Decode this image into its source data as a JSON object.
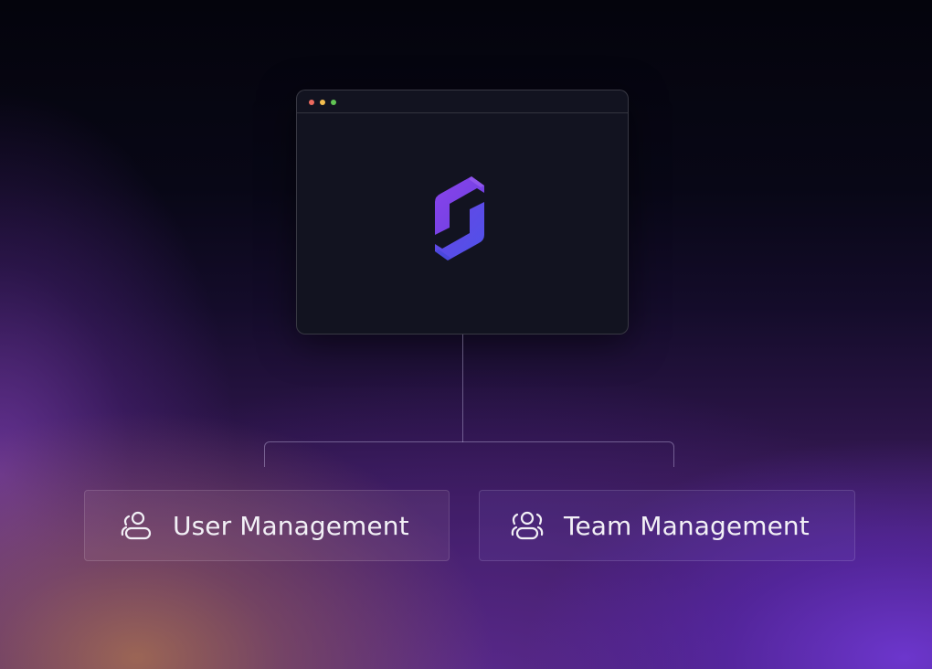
{
  "window": {
    "controls": [
      "red",
      "yellow",
      "green"
    ],
    "control_colors": {
      "red": "#ec6a5e",
      "yellow": "#f4be4f",
      "green": "#61c554"
    },
    "logo": {
      "icon": "s-logo-icon",
      "colors": [
        "#7b3fe4",
        "#5a4be8"
      ]
    }
  },
  "cards": [
    {
      "label": "User Management",
      "icon": "user-icon"
    },
    {
      "label": "Team Management",
      "icon": "team-icon"
    }
  ],
  "colors": {
    "accent_purple": "#6d3fe0",
    "window_background": "#121320"
  }
}
